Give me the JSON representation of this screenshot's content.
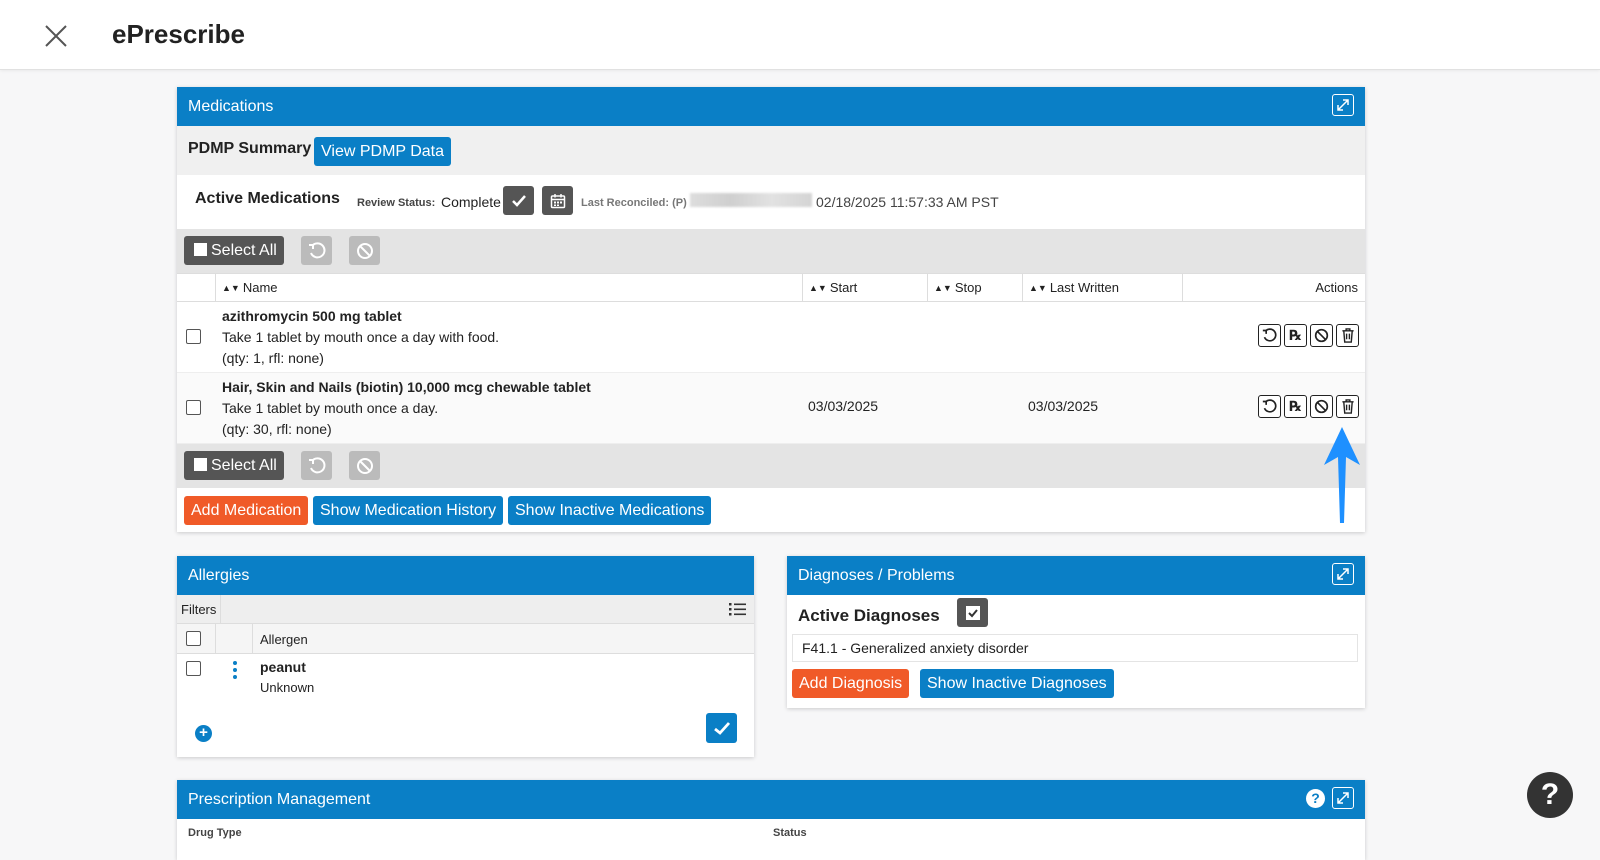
{
  "app": {
    "title": "ePrescribe"
  },
  "medications": {
    "panel_title": "Medications",
    "pdmp_label": "PDMP Summary",
    "pdmp_button": "View PDMP Data",
    "active_label": "Active Medications",
    "review_status_label": "Review Status:",
    "review_status_value": "Complete",
    "last_reconciled_label": "Last Reconciled: (P)",
    "last_reconciled_value": "02/18/2025 11:57:33 AM PST",
    "select_all": "Select All",
    "columns": {
      "name": "Name",
      "start": "Start",
      "stop": "Stop",
      "last_written": "Last Written",
      "actions": "Actions"
    },
    "rows": [
      {
        "name": "azithromycin 500 mg tablet",
        "sig": "Take 1 tablet by mouth once a day with food.",
        "qty": "(qty: 1, rfl: none)",
        "start": "",
        "stop": "",
        "last_written": ""
      },
      {
        "name": "Hair, Skin and Nails (biotin) 10,000 mcg chewable tablet",
        "sig": "Take 1 tablet by mouth once a day.",
        "qty": "(qty: 30, rfl: none)",
        "start": "03/03/2025",
        "stop": "",
        "last_written": "03/03/2025"
      }
    ],
    "rx_icon": "℞",
    "buttons": {
      "add": "Add Medication",
      "history": "Show Medication History",
      "inactive": "Show Inactive Medications"
    }
  },
  "allergies": {
    "panel_title": "Allergies",
    "filters_label": "Filters",
    "column_allergen": "Allergen",
    "items": [
      {
        "name": "peanut",
        "reaction": "Unknown"
      }
    ],
    "add_symbol": "+"
  },
  "diagnoses": {
    "panel_title": "Diagnoses / Problems",
    "active_label": "Active Diagnoses",
    "items": [
      "F41.1 - Generalized anxiety disorder"
    ],
    "buttons": {
      "add": "Add Diagnosis",
      "inactive": "Show Inactive Diagnoses"
    }
  },
  "prescription_management": {
    "panel_title": "Prescription Management",
    "help_symbol": "?",
    "columns": {
      "drug_type": "Drug Type",
      "status": "Status"
    }
  },
  "help_fab": "?",
  "colors": {
    "primary": "#0a7fc6",
    "accent": "#f05a28",
    "dark_button": "#555555",
    "arrow": "#1e90ff"
  }
}
